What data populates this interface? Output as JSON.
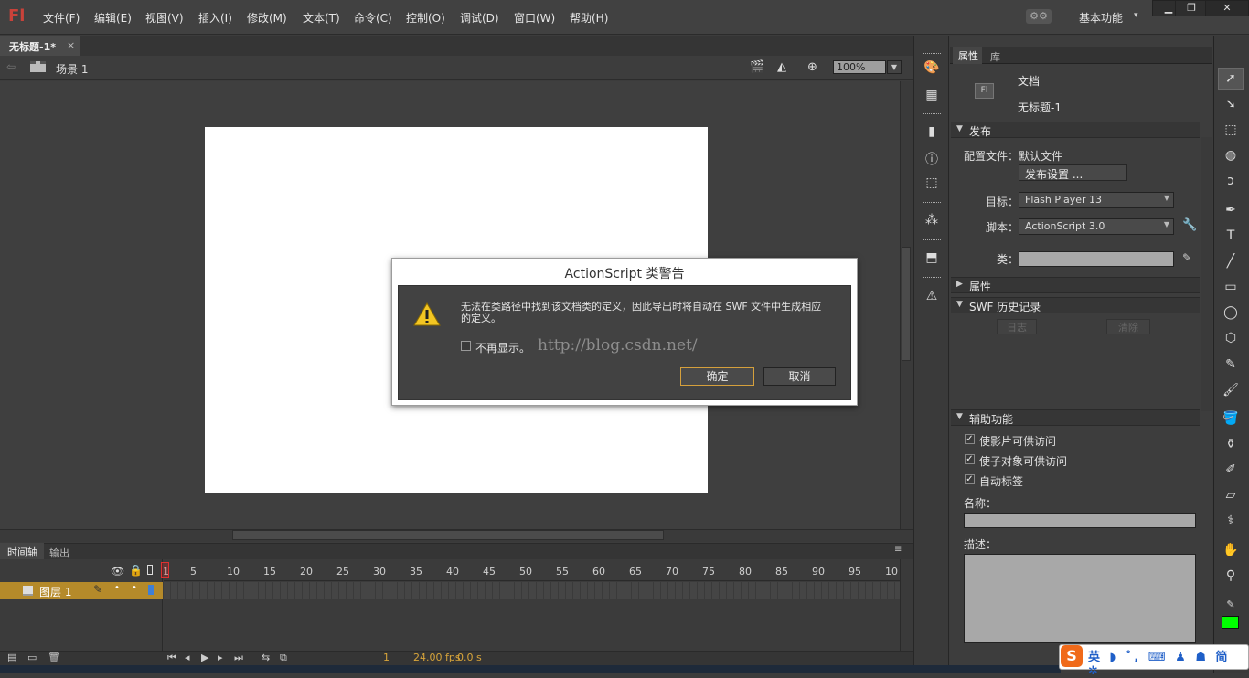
{
  "app": {
    "logo": "Fl"
  },
  "menu": [
    "文件(F)",
    "编辑(E)",
    "视图(V)",
    "插入(I)",
    "修改(M)",
    "文本(T)",
    "命令(C)",
    "控制(O)",
    "调试(D)",
    "窗口(W)",
    "帮助(H)"
  ],
  "workspace": {
    "label": "基本功能",
    "arrow": "▾"
  },
  "window_buttons": {
    "min": "▁",
    "max": "❐",
    "close": "✕"
  },
  "document_tab": {
    "title": "无标题-1*",
    "close": "×"
  },
  "scene": {
    "label": "场景 1",
    "zoom": "100%"
  },
  "timeline": {
    "tabs": [
      "时间轴",
      "输出"
    ],
    "ruler": [
      "1",
      "5",
      "10",
      "15",
      "20",
      "25",
      "30",
      "35",
      "40",
      "45",
      "50",
      "55",
      "60",
      "65",
      "70",
      "75",
      "80",
      "85",
      "90",
      "95",
      "10"
    ],
    "layer_name": "图层 1",
    "current_frame": "1",
    "fps": "24.00 fps",
    "seconds": "0.0 s"
  },
  "properties": {
    "tabs": [
      "属性",
      "库"
    ],
    "doc_icon": "Fl",
    "doc_type": "文档",
    "doc_name": "无标题-1",
    "publish": {
      "header": "发布",
      "profile_label": "配置文件：",
      "profile_value": "默认文件",
      "settings_button": "发布设置 ...",
      "target_label": "目标：",
      "target_value": "Flash Player 13",
      "script_label": "脚本：",
      "script_value": "ActionScript 3.0",
      "class_label": "类："
    },
    "properties_header": "属性",
    "swf_history": {
      "header": "SWF 历史记录",
      "log_button": "日志",
      "clear_button": "清除"
    },
    "accessibility": {
      "header": "辅助功能",
      "options": [
        "使影片可供访问",
        "使子对象可供访问",
        "自动标签"
      ],
      "name_label": "名称：",
      "desc_label": "描述："
    }
  },
  "dialog": {
    "title": "ActionScript 类警告",
    "message": "无法在类路径中找到该文档类的定义，因此导出时将自动在 SWF 文件中生成相应的定义。",
    "checkbox_label": "不再显示。",
    "watermark": "http://blog.csdn.net/",
    "ok": "确定",
    "cancel": "取消"
  },
  "ime": {
    "logo": "S",
    "items": "英 ◗ ˚, ⌨ ♟ ☗ 简 ✲"
  },
  "colors": {
    "fill_color": "#00ff00",
    "accent": "#d5a03c",
    "layer_highlight": "#b58a2a"
  }
}
